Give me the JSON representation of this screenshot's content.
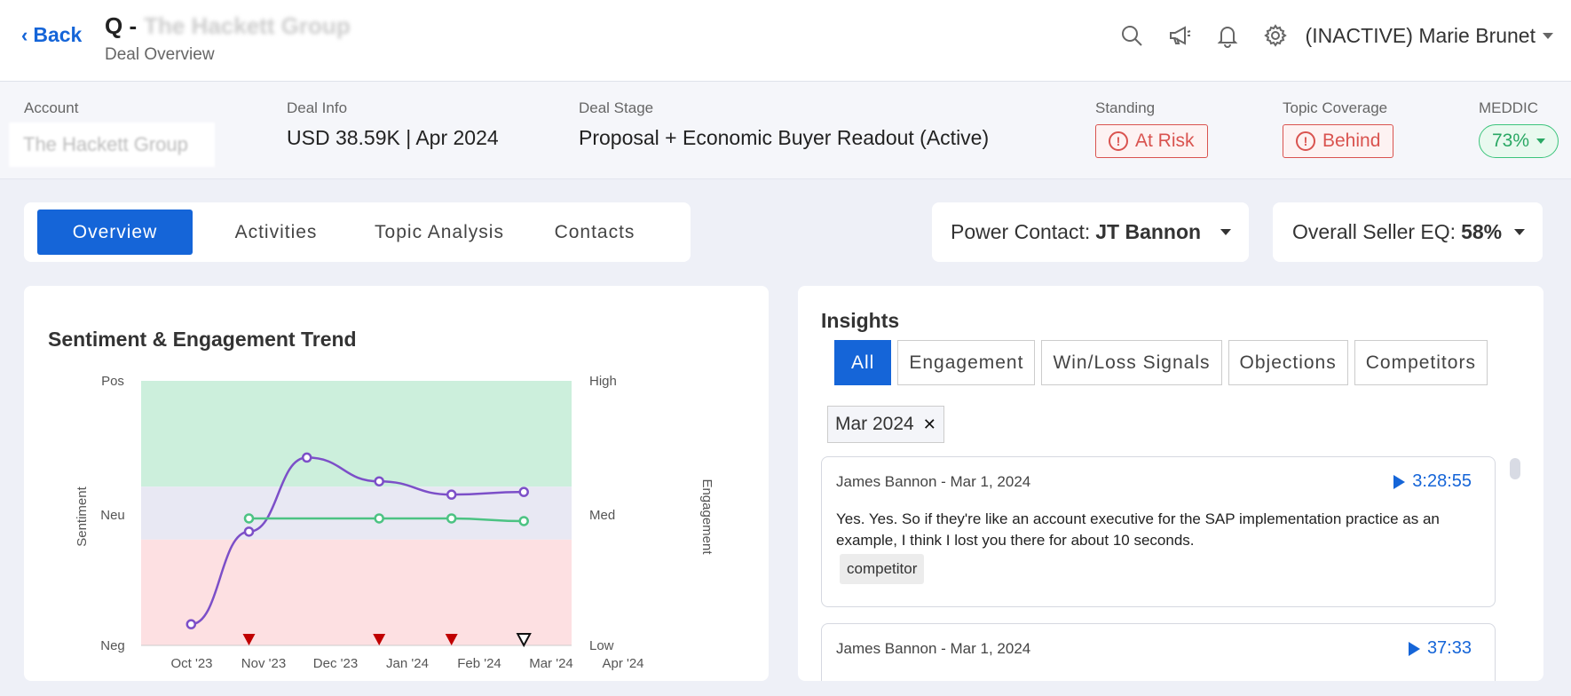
{
  "header": {
    "back_label": "Back",
    "title_prefix": "Q -",
    "title_company": "The Hackett Group",
    "subtitle": "Deal Overview",
    "icons": [
      "search-icon",
      "megaphone-icon",
      "bell-icon",
      "gear-icon"
    ],
    "user_name": "(INACTIVE) Marie Brunet"
  },
  "info": {
    "account_label": "Account",
    "account_value": "The Hackett Group",
    "deal_info_label": "Deal Info",
    "deal_info_value": "USD 38.59K | Apr 2024",
    "deal_stage_label": "Deal Stage",
    "deal_stage_value": "Proposal + Economic Buyer Readout (Active)",
    "standing_label": "Standing",
    "standing_value": "At Risk",
    "topic_label": "Topic Coverage",
    "topic_value": "Behind",
    "meddic_label": "MEDDIC",
    "meddic_value": "73%"
  },
  "tabs": [
    {
      "label": "Overview"
    },
    {
      "label": "Activities"
    },
    {
      "label": "Topic Analysis"
    },
    {
      "label": "Contacts"
    }
  ],
  "power_contact": {
    "label": "Power Contact:",
    "value": "JT Bannon"
  },
  "seller_eq": {
    "label": "Overall Seller EQ:",
    "value": "58%"
  },
  "chart_data": {
    "type": "line",
    "title": "Sentiment & Engagement Trend",
    "ylabel": "Sentiment",
    "y2label": "Engagement",
    "y_ticks": [
      "Pos",
      "Neu",
      "Neg"
    ],
    "y2_ticks": [
      "High",
      "Med",
      "Low"
    ],
    "categories": [
      "Oct '23",
      "Nov '23",
      "Dec '23",
      "Jan '24",
      "Feb '24",
      "Mar '24",
      "Apr '24"
    ],
    "ylim": [
      0,
      100
    ],
    "bands": [
      {
        "from": 60,
        "to": 100,
        "color": "#ccefdc"
      },
      {
        "from": 40,
        "to": 60,
        "color": "#e8e8f3"
      },
      {
        "from": 0,
        "to": 40,
        "color": "#fde0e2"
      }
    ],
    "series": [
      {
        "color": "#7c4fc8",
        "points": [
          [
            0.2,
            8
          ],
          [
            1,
            43
          ],
          [
            1.8,
            71
          ],
          [
            2.8,
            62
          ],
          [
            3.8,
            57
          ],
          [
            4.8,
            58
          ]
        ]
      },
      {
        "color": "#4cc383",
        "points": [
          [
            1,
            48
          ],
          [
            2.8,
            48
          ],
          [
            3.8,
            48
          ],
          [
            4.8,
            47
          ]
        ]
      }
    ],
    "markers": [
      {
        "x": 1,
        "style": "filled",
        "color": "#c00000"
      },
      {
        "x": 2.8,
        "style": "filled",
        "color": "#c00000"
      },
      {
        "x": 3.8,
        "style": "filled",
        "color": "#c00000"
      },
      {
        "x": 4.8,
        "style": "outline",
        "color": "#111111"
      }
    ]
  },
  "insights": {
    "title": "Insights",
    "filters": [
      "All",
      "Engagement",
      "Win/Loss Signals",
      "Objections",
      "Competitors"
    ],
    "chip": "Mar 2024",
    "items": [
      {
        "meta": "James Bannon - Mar 1, 2024",
        "time": "3:28:55",
        "text": "Yes. Yes. So if they're like an account executive for the SAP implementation practice as an example, I think I lost you there for about 10 seconds.",
        "tag": "competitor"
      },
      {
        "meta": "James Bannon - Mar 1, 2024",
        "time": "37:33"
      }
    ]
  }
}
